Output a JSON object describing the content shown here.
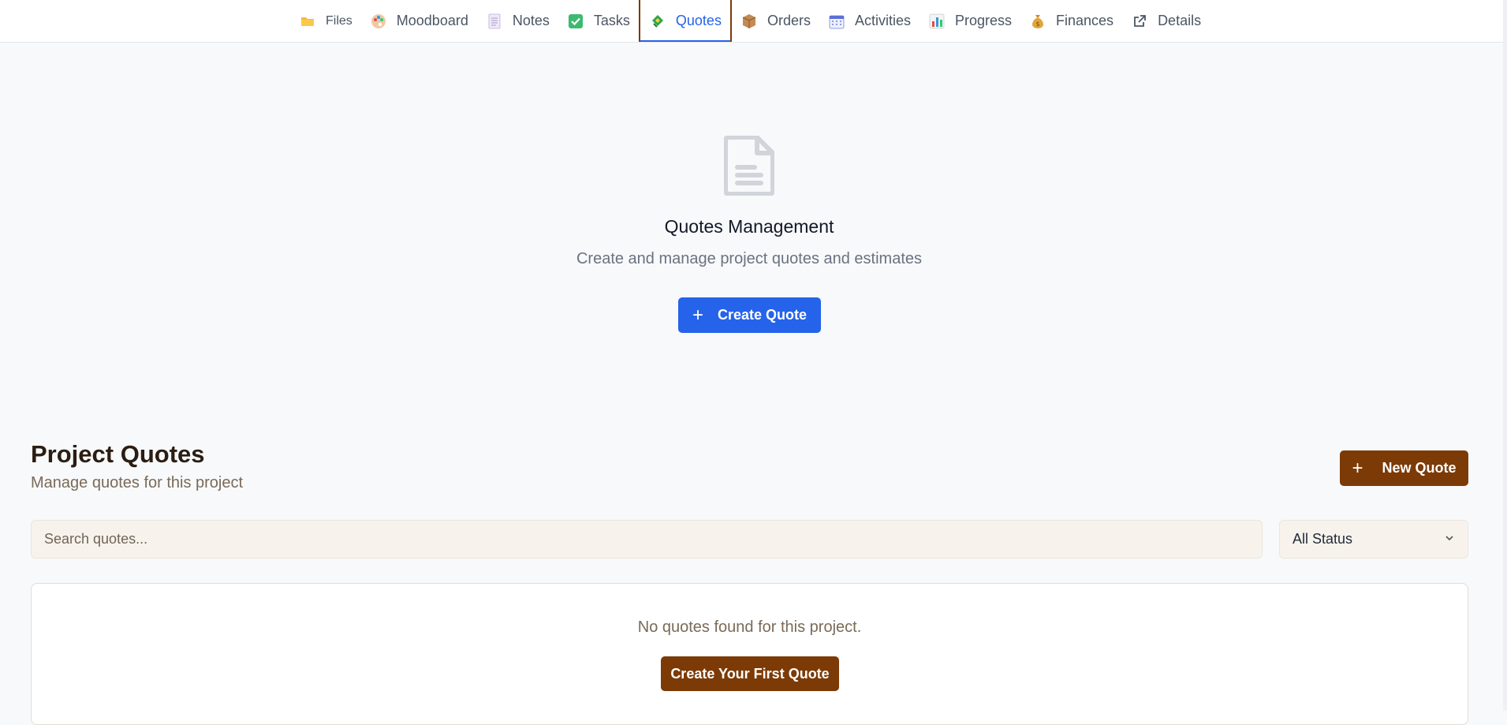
{
  "tabs": [
    {
      "label": "Files",
      "icon": "folder-icon"
    },
    {
      "label": "Moodboard",
      "icon": "palette-icon"
    },
    {
      "label": "Notes",
      "icon": "notepad-icon"
    },
    {
      "label": "Tasks",
      "icon": "checkbox-icon"
    },
    {
      "label": "Quotes",
      "icon": "money-icon",
      "active": true
    },
    {
      "label": "Orders",
      "icon": "package-icon"
    },
    {
      "label": "Activities",
      "icon": "calendar-icon"
    },
    {
      "label": "Progress",
      "icon": "bar-chart-icon"
    },
    {
      "label": "Finances",
      "icon": "money-bag-icon"
    },
    {
      "label": "Details",
      "icon": "external-link-icon"
    }
  ],
  "hero": {
    "icon": "document-icon",
    "title": "Quotes Management",
    "subtitle": "Create and manage project quotes and estimates",
    "button_label": "Create Quote"
  },
  "project_quotes": {
    "title": "Project Quotes",
    "subtitle": "Manage quotes for this project",
    "new_button_label": "New Quote",
    "search_placeholder": "Search quotes...",
    "status_filter": "All Status",
    "empty_message": "No quotes found for this project.",
    "empty_button_label": "Create Your First Quote"
  },
  "colors": {
    "primary_blue": "#2563eb",
    "brand_brown": "#7c3a06"
  }
}
